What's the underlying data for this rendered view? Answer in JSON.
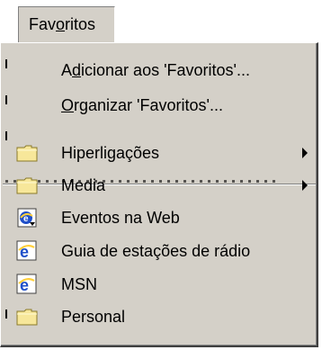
{
  "menubar": {
    "label_before": "Fav",
    "label_underline": "o",
    "label_after": "ritos"
  },
  "menu": {
    "add": {
      "before": "A",
      "underline": "d",
      "after": "icionar aos 'Favoritos'..."
    },
    "organize": {
      "before": "",
      "underline": "O",
      "after": "rganizar 'Favoritos'..."
    },
    "items": [
      {
        "label": "Hiperligações",
        "icon": "folder-icon"
      },
      {
        "label": "Media",
        "icon": "folder-icon"
      },
      {
        "label": "Eventos na Web",
        "icon": "internet-shortcut-icon"
      },
      {
        "label": "Guia de estações de rádio",
        "icon": "internet-explorer-icon"
      },
      {
        "label": "MSN",
        "icon": "internet-explorer-icon"
      },
      {
        "label": "Personal",
        "icon": "folder-icon"
      }
    ]
  },
  "colors": {
    "menu_bg": "#d4d0c8",
    "folder": "#f7e79a",
    "ie_blue": "#1f4fc9"
  }
}
